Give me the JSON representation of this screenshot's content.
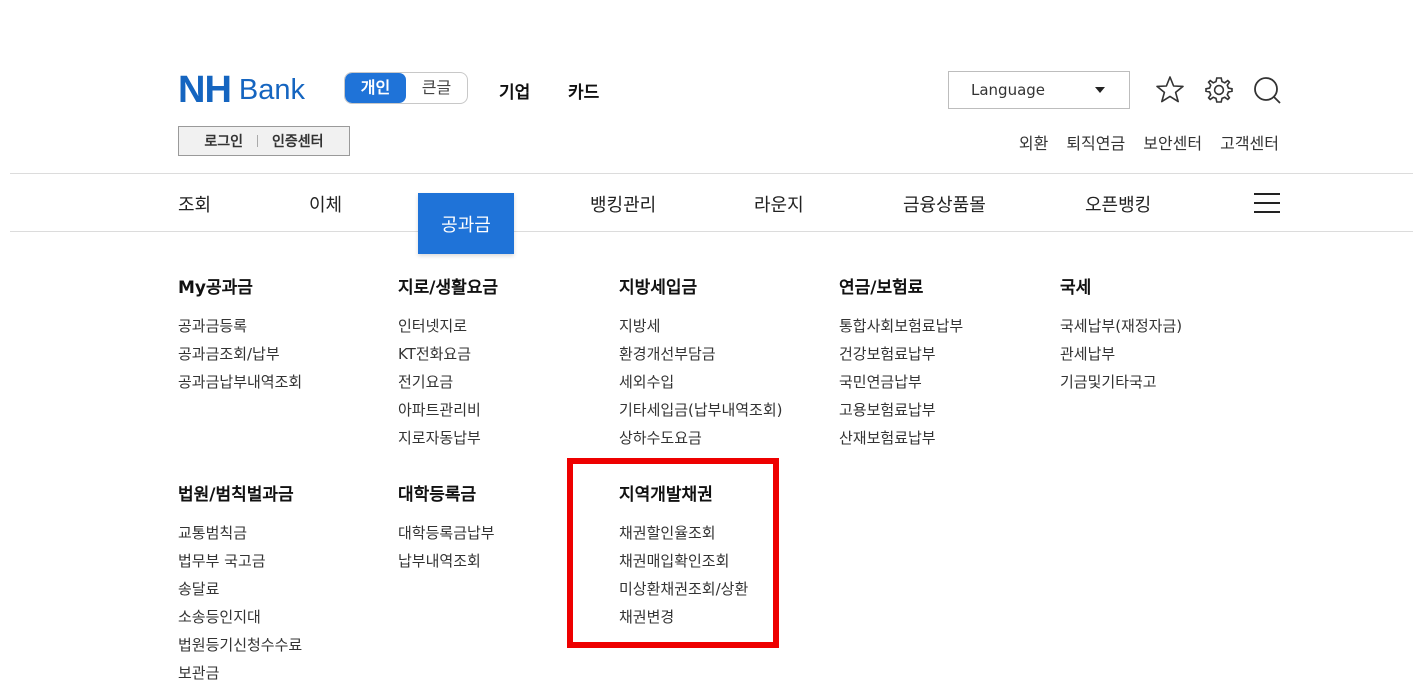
{
  "logo": {
    "nh": "NH",
    "bank": "Bank"
  },
  "segment": {
    "personal": "개인",
    "large_font": "큰글"
  },
  "top_nav": {
    "business": "기업",
    "card": "카드"
  },
  "language": {
    "label": "Language"
  },
  "icons": {
    "favorite": "star-icon",
    "settings": "gear-icon",
    "search": "search-icon",
    "menu": "hamburger-icon"
  },
  "login": {
    "login": "로그인",
    "cert_center": "인증센터"
  },
  "util_links": [
    "외환",
    "퇴직연금",
    "보안센터",
    "고객센터"
  ],
  "gnb": {
    "inquiry": "조회",
    "transfer": "이체",
    "public_fees": "공과금",
    "banking_mgmt": "뱅킹관리",
    "lounge": "라운지",
    "financial_mall": "금융상품몰",
    "open_banking": "오픈뱅킹"
  },
  "menu": {
    "row1": [
      {
        "title": "My공과금",
        "items": [
          "공과금등록",
          "공과금조회/납부",
          "공과금납부내역조회"
        ]
      },
      {
        "title": "지로/생활요금",
        "items": [
          "인터넷지로",
          "KT전화요금",
          "전기요금",
          "아파트관리비",
          "지로자동납부"
        ]
      },
      {
        "title": "지방세입금",
        "items": [
          "지방세",
          "환경개선부담금",
          "세외수입",
          "기타세입금(납부내역조회)",
          "상하수도요금"
        ]
      },
      {
        "title": "연금/보험료",
        "items": [
          "통합사회보험료납부",
          "건강보험료납부",
          "국민연금납부",
          "고용보험료납부",
          "산재보험료납부"
        ]
      },
      {
        "title": "국세",
        "items": [
          "국세납부(재정자금)",
          "관세납부",
          "기금및기타국고"
        ]
      }
    ],
    "row2": [
      {
        "title": "법원/범칙벌과금",
        "items": [
          "교통범칙금",
          "법무부 국고금",
          "송달료",
          "소송등인지대",
          "법원등기신청수수료",
          "보관금"
        ]
      },
      {
        "title": "대학등록금",
        "items": [
          "대학등록금납부",
          "납부내역조회"
        ]
      },
      {
        "title": "지역개발채권",
        "items": [
          "채권할인율조회",
          "채권매입확인조회",
          "미상환채권조회/상환",
          "채권변경"
        ]
      }
    ]
  },
  "colors": {
    "brand": "#1565c0",
    "accent": "#1f73d8",
    "highlight": "#ee0000"
  }
}
